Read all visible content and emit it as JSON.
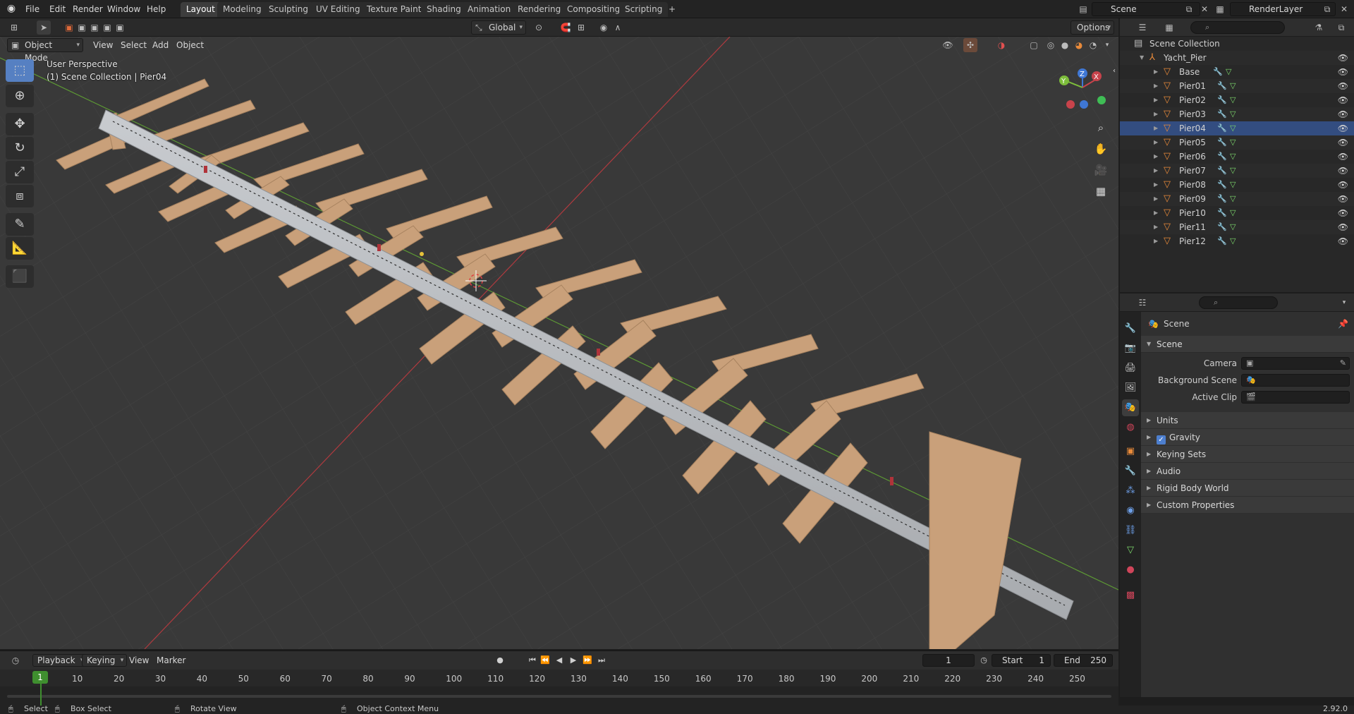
{
  "menu": [
    "File",
    "Edit",
    "Render",
    "Window",
    "Help"
  ],
  "workspaces": [
    "Layout",
    "Modeling",
    "Sculpting",
    "UV Editing",
    "Texture Paint",
    "Shading",
    "Animation",
    "Rendering",
    "Compositing",
    "Scripting"
  ],
  "add_workspace": "+",
  "scene_name": "Scene",
  "render_layer": "RenderLayer",
  "header": {
    "mode": "Object Mode",
    "view": "View",
    "select": "Select",
    "add": "Add",
    "object": "Object",
    "orientation": "Global",
    "options": "Options"
  },
  "viewport": {
    "perspective": "User Perspective",
    "collection_info": "(1) Scene Collection | Pier04",
    "axes": {
      "x": "X",
      "y": "Y",
      "z": "Z"
    }
  },
  "outliner": {
    "root": "Scene Collection",
    "collection": "Yacht_Pier",
    "items": [
      "Base",
      "Pier01",
      "Pier02",
      "Pier03",
      "Pier04",
      "Pier05",
      "Pier06",
      "Pier07",
      "Pier08",
      "Pier09",
      "Pier10",
      "Pier11",
      "Pier12"
    ],
    "selected": "Pier04"
  },
  "properties": {
    "context": "Scene",
    "panel": "Scene",
    "camera_label": "Camera",
    "background_scene_label": "Background Scene",
    "active_clip_label": "Active Clip",
    "subpanels": [
      "Units",
      "Gravity",
      "Keying Sets",
      "Audio",
      "Rigid Body World",
      "Custom Properties"
    ],
    "gravity_checked": true
  },
  "timeline": {
    "playback": "Playback",
    "keying": "Keying",
    "view": "View",
    "marker": "Marker",
    "current_frame": "1",
    "start_label": "Start",
    "start": "1",
    "end_label": "End",
    "end": "250",
    "ruler": [
      "1",
      "10",
      "20",
      "30",
      "40",
      "50",
      "60",
      "70",
      "80",
      "90",
      "100",
      "110",
      "120",
      "130",
      "140",
      "150",
      "160",
      "170",
      "180",
      "190",
      "200",
      "210",
      "220",
      "230",
      "240",
      "250"
    ]
  },
  "statusbar": {
    "select": "Select",
    "box_select": "Box Select",
    "rotate_view": "Rotate View",
    "context_menu": "Object Context Menu",
    "version": "2.92.0"
  },
  "colors": {
    "accent": "#5680c2",
    "object_icon": "#e88a3a",
    "selected_row": "#334d80",
    "current_frame": "#3f8f2f",
    "axis_x": "#c8434b",
    "axis_y": "#7dbd3b",
    "axis_z": "#3f77d4",
    "deck": "#c9a07a",
    "walkway": "#b9bcc0"
  }
}
